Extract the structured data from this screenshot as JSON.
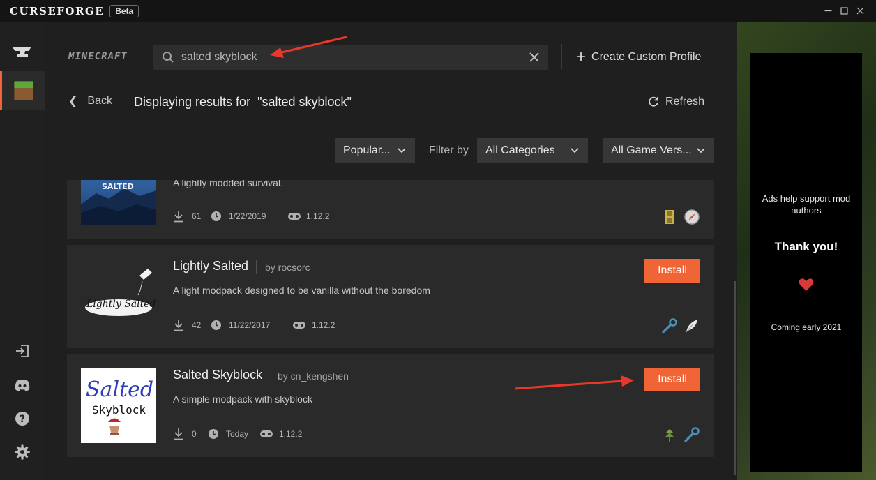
{
  "titlebar": {
    "brand": "CURSEFORGE",
    "badge": "Beta",
    "controls": [
      "minimize-icon",
      "maximize-icon",
      "close-icon"
    ]
  },
  "sidebar": {
    "top": [
      {
        "name": "anvil-icon"
      },
      {
        "name": "minecraft-grass-block-icon",
        "active": true
      }
    ],
    "bottom": [
      {
        "name": "sign-in-icon"
      },
      {
        "name": "discord-icon"
      },
      {
        "name": "help-icon"
      },
      {
        "name": "settings-gear-icon"
      }
    ]
  },
  "header": {
    "game_logo": "MINECRAFT",
    "search": {
      "value": "salted skyblock",
      "icon": "search-icon",
      "clear_icon": "clear-icon"
    },
    "create_profile": "Create Custom Profile"
  },
  "subheader": {
    "back": "Back",
    "results_prefix": "Displaying results for",
    "results_query": "\"salted skyblock\"",
    "refresh": "Refresh"
  },
  "filters": {
    "sort": "Popular...",
    "filter_label": "Filter by",
    "category": "All Categories",
    "game_version": "All Game Vers..."
  },
  "results": [
    {
      "title": "",
      "author": "",
      "thumb_text": "SALTED",
      "description": "A lightly modded survival.",
      "downloads": "61",
      "updated": "1/22/2019",
      "version": "1.12.2",
      "install_visible": false,
      "category_icons": [
        "door-icon",
        "compass-icon"
      ]
    },
    {
      "title": "Lightly Salted",
      "author": "by rocsorc",
      "thumb_text": "Lightly Salted",
      "description": "A light modpack designed to be vanilla without the boredom",
      "downloads": "42",
      "updated": "11/22/2017",
      "version": "1.12.2",
      "install_label": "Install",
      "install_visible": true,
      "category_icons": [
        "wrench-icon",
        "feather-icon"
      ]
    },
    {
      "title": "Salted Skyblock",
      "author": "by cn_kengshen",
      "thumb_text": "Salted",
      "thumb_sub": "Skyblock",
      "description": "A simple modpack with skyblock",
      "downloads": "0",
      "updated": "Today",
      "version": "1.12.2",
      "install_label": "Install",
      "install_visible": true,
      "category_icons": [
        "sapling-icon",
        "wrench-icon"
      ]
    }
  ],
  "ad": {
    "line1": "Ads help support mod authors",
    "line2": "Thank you!",
    "icon": "heart-icon",
    "line3": "Coming early 2021"
  },
  "colors": {
    "accent": "#f16436",
    "card": "#2a2a2a",
    "background": "#1f1f1f",
    "rail": "#202020",
    "annotation_arrow": "#e8382b"
  }
}
